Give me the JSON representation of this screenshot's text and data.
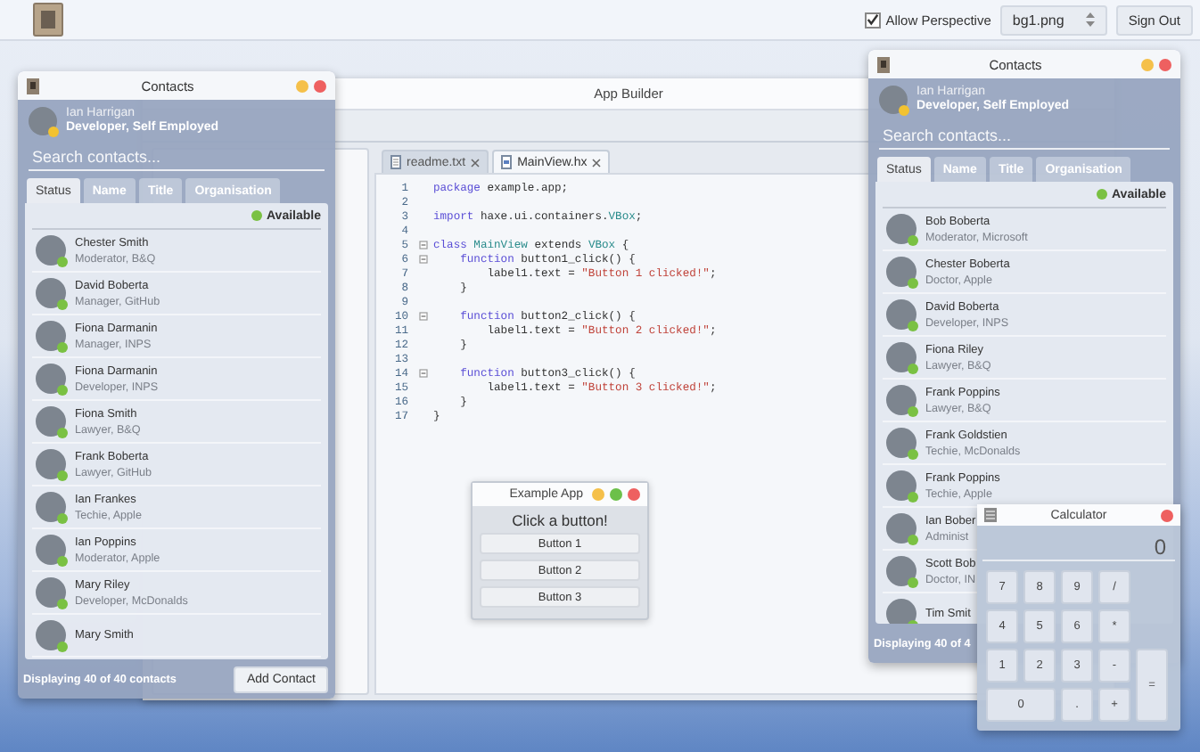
{
  "topbar": {
    "perspective": {
      "label": "Allow Perspective",
      "checked": true
    },
    "background_select": {
      "value": "bg1.png"
    },
    "sign_out": "Sign Out"
  },
  "app_builder": {
    "title": "App Builder",
    "editor": {
      "tabs": [
        {
          "label": "readme.txt",
          "kind": "text",
          "selected": false
        },
        {
          "label": "MainView.hx",
          "kind": "code",
          "selected": true
        }
      ],
      "lines": [
        {
          "number": "1",
          "fold": false,
          "tokens": [
            {
              "text": "package",
              "kind": "keyword"
            },
            {
              "text": " example.app;",
              "kind": "plain"
            }
          ]
        },
        {
          "number": "2",
          "fold": false
        },
        {
          "number": "3",
          "fold": false,
          "tokens": [
            {
              "text": "import",
              "kind": "keyword"
            },
            {
              "text": " haxe.ui.containers.",
              "kind": "plain"
            },
            {
              "text": "VBox",
              "kind": "type"
            },
            {
              "text": ";",
              "kind": "plain"
            }
          ]
        },
        {
          "number": "4",
          "fold": false
        },
        {
          "number": "5",
          "fold": true,
          "tokens": [
            {
              "text": "class",
              "kind": "keyword"
            },
            {
              "text": " MainView",
              "kind": "type"
            },
            {
              "text": " extends ",
              "kind": "plain"
            },
            {
              "text": "VBox",
              "kind": "type"
            },
            {
              "text": " {",
              "kind": "plain"
            }
          ]
        },
        {
          "number": "6",
          "fold": true,
          "tokens": [
            {
              "text": "    function",
              "kind": "keyword"
            },
            {
              "text": " button1_click() {",
              "kind": "plain"
            }
          ]
        },
        {
          "number": "7",
          "fold": false,
          "tokens": [
            {
              "text": "        label1.text = ",
              "kind": "plain"
            },
            {
              "text": "\"Button 1 clicked!\"",
              "kind": "string"
            },
            {
              "text": ";",
              "kind": "plain"
            }
          ]
        },
        {
          "number": "8",
          "fold": false,
          "tokens": [
            {
              "text": "    }",
              "kind": "plain"
            }
          ]
        },
        {
          "number": "9",
          "fold": false
        },
        {
          "number": "10",
          "fold": true,
          "tokens": [
            {
              "text": "    function",
              "kind": "keyword"
            },
            {
              "text": " button2_click() {",
              "kind": "plain"
            }
          ]
        },
        {
          "number": "11",
          "fold": false,
          "tokens": [
            {
              "text": "        label1.text = ",
              "kind": "plain"
            },
            {
              "text": "\"Button 2 clicked!\"",
              "kind": "string"
            },
            {
              "text": ";",
              "kind": "plain"
            }
          ]
        },
        {
          "number": "12",
          "fold": false,
          "tokens": [
            {
              "text": "    }",
              "kind": "plain"
            }
          ]
        },
        {
          "number": "13",
          "fold": false
        },
        {
          "number": "14",
          "fold": true,
          "tokens": [
            {
              "text": "    function",
              "kind": "keyword"
            },
            {
              "text": " button3_click() {",
              "kind": "plain"
            }
          ]
        },
        {
          "number": "15",
          "fold": false,
          "tokens": [
            {
              "text": "        label1.text = ",
              "kind": "plain"
            },
            {
              "text": "\"Button 3 clicked!\"",
              "kind": "string"
            },
            {
              "text": ";",
              "kind": "plain"
            }
          ]
        },
        {
          "number": "16",
          "fold": false,
          "tokens": [
            {
              "text": "    }",
              "kind": "plain"
            }
          ]
        },
        {
          "number": "17",
          "fold": false,
          "tokens": [
            {
              "text": "}",
              "kind": "plain"
            }
          ]
        }
      ]
    }
  },
  "contacts_left": {
    "title": "Contacts",
    "controls": [
      {
        "kind": "minimize"
      },
      {
        "kind": "close"
      }
    ],
    "user": {
      "name": "Ian Harrigan",
      "role": "Developer, Self Employed",
      "color": "#f2c230"
    },
    "search": {
      "placeholder": "Search contacts..."
    },
    "tabs": [
      {
        "label": "Status",
        "selected": true
      },
      {
        "label": "Name",
        "selected": false
      },
      {
        "label": "Title",
        "selected": false
      },
      {
        "label": "Organisation",
        "selected": false
      }
    ],
    "filter": {
      "label": "Available",
      "color": "#7ac143"
    },
    "contacts": [
      {
        "name": "Chester Smith",
        "role": "Moderator, B&Q",
        "color": "#7ac143"
      },
      {
        "name": "David Boberta",
        "role": "Manager, GitHub",
        "color": "#7ac143"
      },
      {
        "name": "Fiona Darmanin",
        "role": "Manager, INPS",
        "color": "#7ac143"
      },
      {
        "name": "Fiona Darmanin",
        "role": "Developer, INPS",
        "color": "#7ac143"
      },
      {
        "name": "Fiona Smith",
        "role": "Lawyer, B&Q",
        "color": "#7ac143"
      },
      {
        "name": "Frank Boberta",
        "role": "Lawyer, GitHub",
        "color": "#7ac143"
      },
      {
        "name": "Ian Frankes",
        "role": "Techie, Apple",
        "color": "#7ac143"
      },
      {
        "name": "Ian Poppins",
        "role": "Moderator, Apple",
        "color": "#7ac143"
      },
      {
        "name": "Mary Riley",
        "role": "Developer, McDonalds",
        "color": "#7ac143"
      },
      {
        "name": "Mary Smith",
        "color": "#7ac143"
      }
    ],
    "footer": "Displaying 40 of 40 contacts",
    "add_button": "Add Contact"
  },
  "contacts_right": {
    "title": "Contacts",
    "controls": [
      {
        "kind": "minimize"
      },
      {
        "kind": "close"
      }
    ],
    "user": {
      "name": "Ian Harrigan",
      "role": "Developer, Self Employed",
      "color": "#f2c230"
    },
    "search": {
      "placeholder": "Search contacts..."
    },
    "tabs": [
      {
        "label": "Status",
        "selected": true
      },
      {
        "label": "Name",
        "selected": false
      },
      {
        "label": "Title",
        "selected": false
      },
      {
        "label": "Organisation",
        "selected": false
      }
    ],
    "filter": {
      "label": "Available",
      "color": "#7ac143"
    },
    "contacts": [
      {
        "name": "Bob Boberta",
        "role": "Moderator, Microsoft",
        "color": "#7ac143"
      },
      {
        "name": "Chester Boberta",
        "role": "Doctor, Apple",
        "color": "#7ac143"
      },
      {
        "name": "David Boberta",
        "role": "Developer, INPS",
        "color": "#7ac143"
      },
      {
        "name": "Fiona Riley",
        "role": "Lawyer, B&Q",
        "color": "#7ac143"
      },
      {
        "name": "Frank Poppins",
        "role": "Lawyer, B&Q",
        "color": "#7ac143"
      },
      {
        "name": "Frank Goldstien",
        "role": "Techie, McDonalds",
        "color": "#7ac143"
      },
      {
        "name": "Frank Poppins",
        "role": "Techie, Apple",
        "color": "#7ac143"
      },
      {
        "name": "Ian Bober",
        "role": "Administ",
        "color": "#7ac143"
      },
      {
        "name": "Scott Bob",
        "role": "Doctor, IN",
        "color": "#7ac143"
      },
      {
        "name": "Tim Smit",
        "color": "#7ac143"
      }
    ],
    "footer": "Displaying 40 of 4"
  },
  "example_app": {
    "title": "Example App",
    "controls": [
      {
        "kind": "minimize"
      },
      {
        "kind": "maximize"
      },
      {
        "kind": "close"
      }
    ],
    "label": "Click a button!",
    "buttons": [
      "Button 1",
      "Button 2",
      "Button 3"
    ]
  },
  "calculator": {
    "title": "Calculator",
    "controls": [
      {
        "kind": "close"
      }
    ],
    "display": "0",
    "rows": [
      [
        {
          "label": "7",
          "kind": "key"
        },
        {
          "label": "8",
          "kind": "key"
        },
        {
          "label": "9",
          "kind": "key"
        },
        {
          "label": "/",
          "kind": "key"
        }
      ],
      [
        {
          "label": "4",
          "kind": "key"
        },
        {
          "label": "5",
          "kind": "key"
        },
        {
          "label": "6",
          "kind": "key"
        },
        {
          "label": "*",
          "kind": "key"
        }
      ],
      [
        {
          "label": "1",
          "kind": "key"
        },
        {
          "label": "2",
          "kind": "key"
        },
        {
          "label": "3",
          "kind": "key"
        },
        {
          "label": "-",
          "kind": "key"
        },
        {
          "label": "=",
          "kind": "tall"
        }
      ],
      [
        {
          "label": "0",
          "kind": "wide"
        },
        {
          "kind": "spanned"
        },
        {
          "label": ".",
          "kind": "key"
        },
        {
          "label": "+",
          "kind": "key"
        }
      ]
    ]
  }
}
